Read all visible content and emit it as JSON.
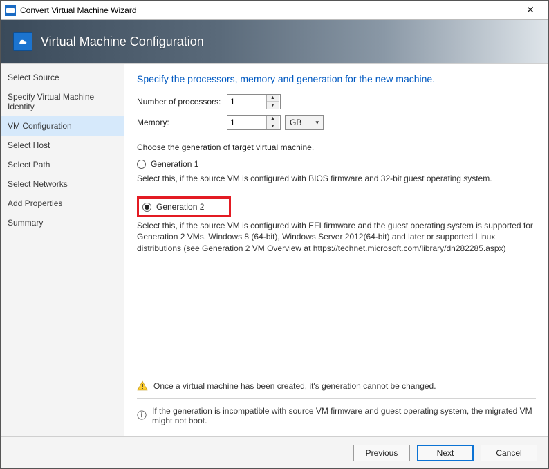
{
  "window": {
    "title": "Convert Virtual Machine Wizard"
  },
  "banner": {
    "title": "Virtual Machine Configuration"
  },
  "sidebar": {
    "items": [
      {
        "label": "Select Source"
      },
      {
        "label": "Specify Virtual Machine Identity"
      },
      {
        "label": "VM Configuration"
      },
      {
        "label": "Select Host"
      },
      {
        "label": "Select Path"
      },
      {
        "label": "Select Networks"
      },
      {
        "label": "Add Properties"
      },
      {
        "label": "Summary"
      }
    ],
    "active_index": 2
  },
  "content": {
    "heading": "Specify the processors, memory and generation for the new machine.",
    "processors_label": "Number of processors:",
    "processors_value": "1",
    "memory_label": "Memory:",
    "memory_value": "1",
    "memory_unit": "GB",
    "generation_prompt": "Choose the generation of target virtual machine.",
    "gen1": {
      "label": "Generation 1",
      "desc": "Select this, if the source VM is configured with BIOS firmware and 32-bit guest operating system."
    },
    "gen2": {
      "label": "Generation 2",
      "desc": "Select this, if the source VM is configured with EFI firmware and the guest operating system is supported for Generation 2 VMs. Windows 8 (64-bit), Windows Server 2012(64-bit) and later or supported Linux distributions (see Generation 2 VM Overview at https://technet.microsoft.com/library/dn282285.aspx)"
    },
    "selected_generation": "gen2",
    "warning": "Once a virtual machine has been created, it's generation cannot be changed.",
    "info": "If the generation is incompatible with source VM firmware and guest operating system, the migrated VM might not boot."
  },
  "footer": {
    "previous": "Previous",
    "next": "Next",
    "cancel": "Cancel"
  }
}
